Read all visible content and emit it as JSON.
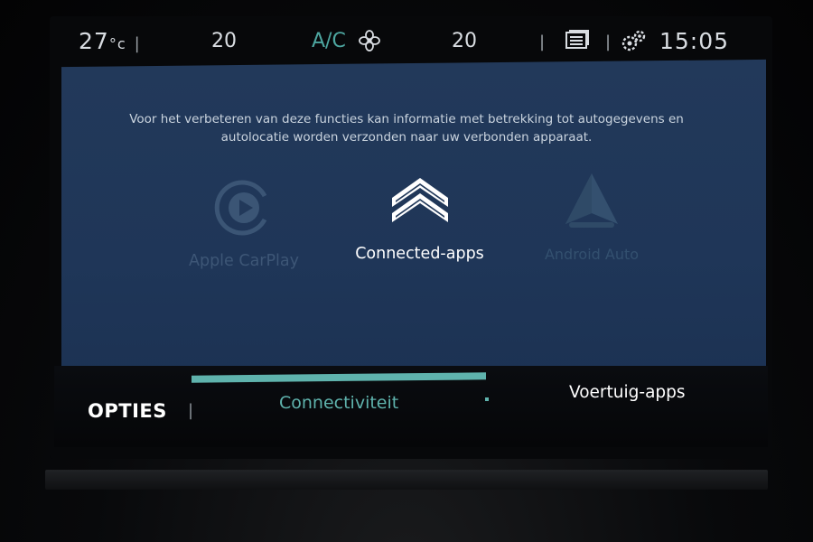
{
  "status_bar": {
    "outside_temp": "27",
    "outside_temp_unit": "°c",
    "temp_left": "20",
    "ac_label": "A/C",
    "temp_right": "20",
    "time": "15:05",
    "icons": [
      "fan-icon",
      "list-icon",
      "settings-gear-icon"
    ]
  },
  "main": {
    "info_text": "Voor het verbeteren van deze functies kan informatie met betrekking tot autogegevens en autolocatie worden verzonden naar uw verbonden apparaat.",
    "apps": [
      {
        "label": "Apple CarPlay",
        "icon": "carplay-play-icon",
        "enabled": false
      },
      {
        "label": "Connected-apps",
        "icon": "citroen-chevrons-icon",
        "enabled": true
      },
      {
        "label": "Android Auto",
        "icon": "android-auto-icon",
        "enabled": false
      }
    ]
  },
  "tabs": {
    "opties_label": "OPTIES",
    "items": [
      {
        "label": "Connectiviteit",
        "active": true
      },
      {
        "label": "Voertuig-apps",
        "active": false
      }
    ]
  },
  "colors": {
    "accent": "#5fb3ad",
    "panel": "#22395a",
    "background": "#07080a"
  }
}
